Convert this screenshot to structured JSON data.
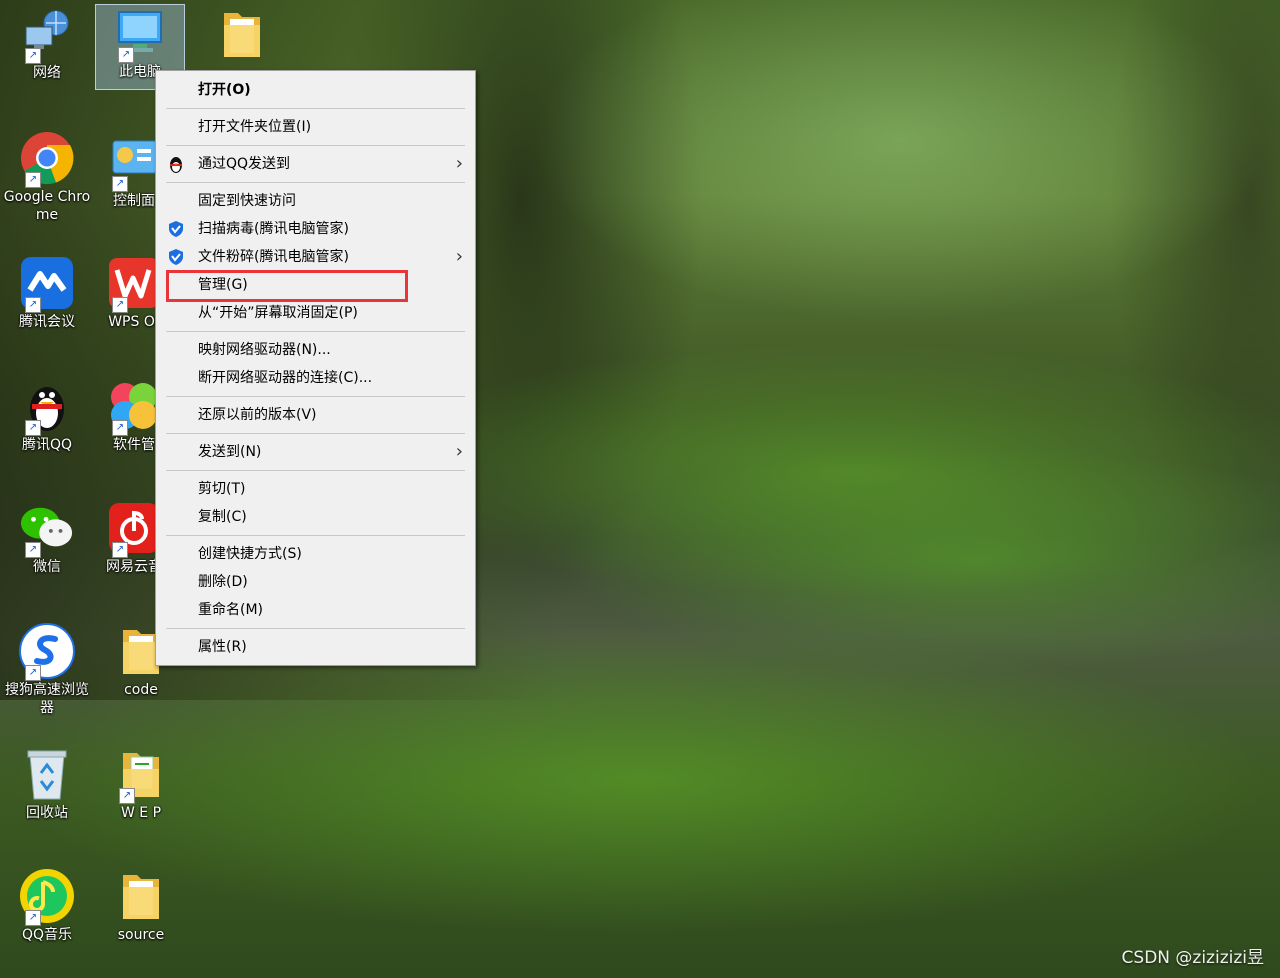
{
  "desktop_icons": {
    "network": "网络",
    "this_pc": "此电脑",
    "chrome": "Google Chrome",
    "control_panel": "控制面",
    "tencent_meeting": "腾讯会议",
    "wps": "WPS Of",
    "qq": "腾讯QQ",
    "software_mgr": "软件管",
    "wechat": "微信",
    "netease": "网易云音",
    "sogou": "搜狗高速浏览器",
    "code": "code",
    "recycle_bin": "回收站",
    "wep": "W E P",
    "qq_music": "QQ音乐",
    "source": "source"
  },
  "context_menu": {
    "items": [
      {
        "label": "打开(O)"
      },
      {
        "label": "打开文件夹位置(I)"
      },
      {
        "label": "通过QQ发送到"
      },
      {
        "label": "固定到快速访问"
      },
      {
        "label": "扫描病毒(腾讯电脑管家)"
      },
      {
        "label": "文件粉碎(腾讯电脑管家)"
      },
      {
        "label": "管理(G)"
      },
      {
        "label": "从“开始”屏幕取消固定(P)"
      },
      {
        "label": "映射网络驱动器(N)..."
      },
      {
        "label": "断开网络驱动器的连接(C)..."
      },
      {
        "label": "还原以前的版本(V)"
      },
      {
        "label": "发送到(N)"
      },
      {
        "label": "剪切(T)"
      },
      {
        "label": "复制(C)"
      },
      {
        "label": "创建快捷方式(S)"
      },
      {
        "label": "删除(D)"
      },
      {
        "label": "重命名(M)"
      },
      {
        "label": "属性(R)"
      }
    ],
    "submenu_arrow": "›"
  },
  "watermark": "CSDN @zizizizi昱",
  "colors": {
    "highlight_box": "#e8353b",
    "menu_bg": "#f0f0f0",
    "tencent_blue": "#1a6fe0"
  }
}
